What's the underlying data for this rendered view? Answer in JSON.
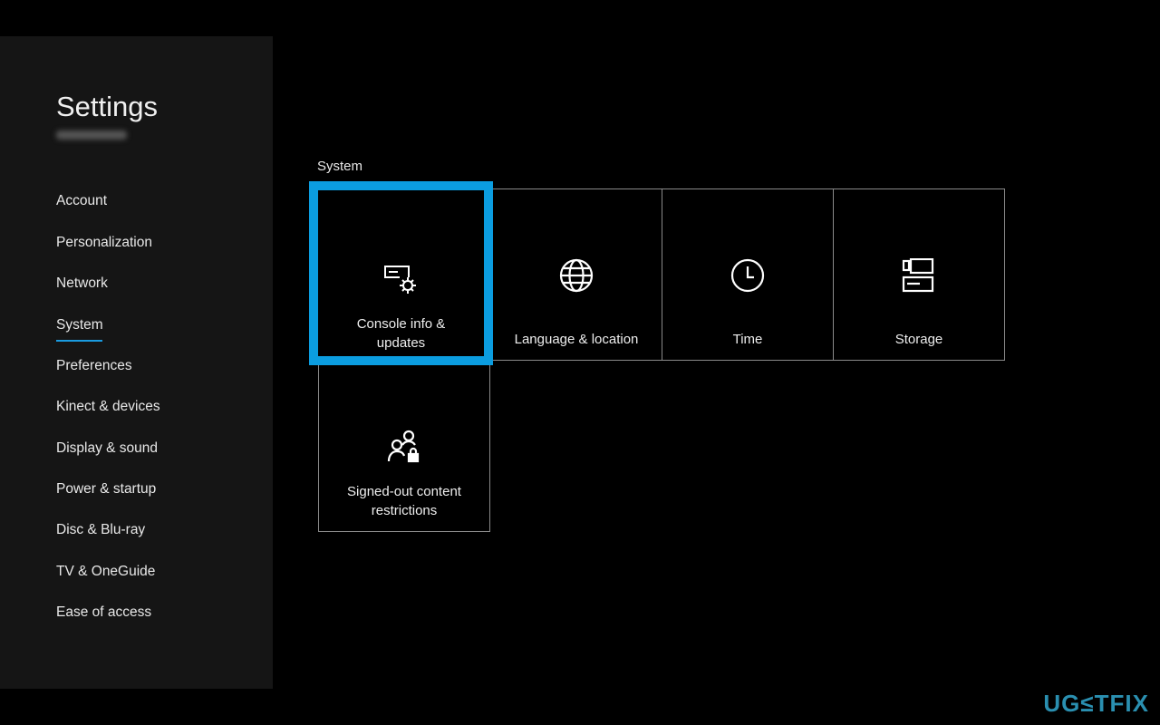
{
  "sidebar": {
    "title": "Settings",
    "items": [
      {
        "label": "Account"
      },
      {
        "label": "Personalization"
      },
      {
        "label": "Network"
      },
      {
        "label": "System",
        "active": true
      },
      {
        "label": "Preferences"
      },
      {
        "label": "Kinect & devices"
      },
      {
        "label": "Display & sound"
      },
      {
        "label": "Power & startup"
      },
      {
        "label": "Disc & Blu-ray"
      },
      {
        "label": "TV & OneGuide"
      },
      {
        "label": "Ease of access"
      }
    ]
  },
  "main": {
    "section": "System",
    "tiles": [
      {
        "label": "Console info & updates",
        "icon": "console-gear-icon",
        "selected": true
      },
      {
        "label": "Language & location",
        "icon": "globe-icon"
      },
      {
        "label": "Time",
        "icon": "clock-icon"
      },
      {
        "label": "Storage",
        "icon": "storage-icon"
      },
      {
        "label": "Signed-out content restrictions",
        "icon": "people-lock-icon"
      }
    ]
  },
  "watermark": "UG≤TFIX",
  "colors": {
    "accent": "#0b9de0"
  }
}
